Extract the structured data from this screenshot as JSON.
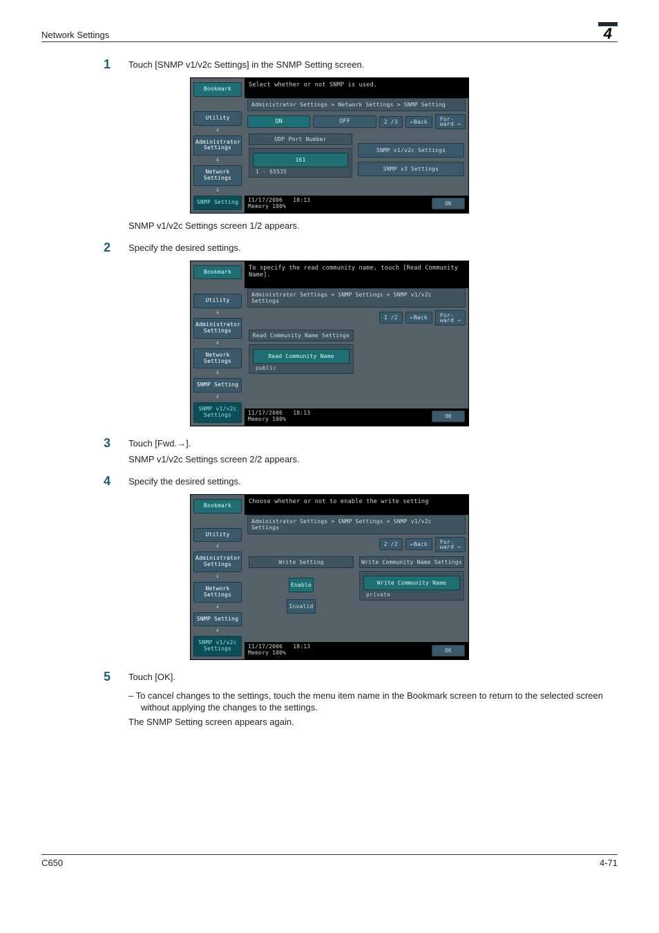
{
  "header": {
    "title": "Network Settings",
    "chapter": "4"
  },
  "steps": {
    "s1": {
      "num": "1",
      "text": "Touch [SNMP v1/v2c Settings] in the SNMP Setting screen.",
      "after": "SNMP v1/v2c Settings screen 1/2 appears."
    },
    "s2": {
      "num": "2",
      "text": "Specify the desired settings."
    },
    "s3": {
      "num": "3",
      "text": "Touch [Fwd.→].",
      "after": "SNMP v1/v2c Settings screen 2/2 appears."
    },
    "s4": {
      "num": "4",
      "text": "Specify the desired settings."
    },
    "s5": {
      "num": "5",
      "text": "Touch [OK].",
      "bullet": "–   To cancel changes to the settings, touch the menu item name in the Bookmark screen to return to the selected screen without applying the changes to the settings.",
      "after": "The SNMP Setting screen appears again."
    }
  },
  "footer": {
    "left": "C650",
    "right": "4-71"
  },
  "shot1": {
    "instr": "Select whether or not SNMP is used.",
    "crumb": "Administrator Settings > Network Settings > SNMP Setting",
    "on": "ON",
    "off": "OFF",
    "page": "2 /3",
    "back": "←Back",
    "fwd": "For-\nward →",
    "bm": {
      "book": "Bookmark",
      "utility": "Utility",
      "admin": "Administrator\nSettings",
      "net": "Network\nSettings",
      "snmp": "SNMP Setting"
    },
    "udpTitle": "UDP Port Number",
    "udpVal": "161",
    "udpRange": "1  -  65535",
    "btnV1": "SNMP v1/v2c Settings",
    "btnV3": "SNMP v3 Settings",
    "date": "11/17/2006",
    "time": "18:13",
    "mem": "Memory   100%",
    "ok": "OK"
  },
  "shot2": {
    "instr": "To specify the read community name, touch [Read Community Name].",
    "crumb": "Administrator Settings > SNMP Settings > SNMP v1/v2c Settings",
    "page": "1 /2",
    "back": "←Back",
    "fwd": "For-\nward →",
    "bm": {
      "book": "Bookmark",
      "utility": "Utility",
      "admin": "Administrator\nSettings",
      "net": "Network\nSettings",
      "snmp": "SNMP Setting",
      "v1": "SNMP v1/v2c\nSettings"
    },
    "panelTitle": "Read Community Name Settings",
    "btnRead": "Read Community Name",
    "val": "public",
    "date": "11/17/2006",
    "time": "18:13",
    "mem": "Memory   100%",
    "ok": "OK"
  },
  "shot3": {
    "instr": "Choose whether or not to enable the write setting",
    "crumb": "Administrator Settings > SNMP Settings > SNMP v1/v2c Settings",
    "page": "2 /2",
    "back": "←Back",
    "fwd": "For-\nward →",
    "bm": {
      "book": "Bookmark",
      "utility": "Utility",
      "admin": "Administrator\nSettings",
      "net": "Network\nSettings",
      "snmp": "SNMP Setting",
      "v1": "SNMP v1/v2c\nSettings"
    },
    "leftTitle": "Write Setting",
    "enable": "Enable",
    "invalid": "Invalid",
    "rightTitle": "Write Community Name Settings",
    "btnWrite": "Write Community Name",
    "val": "private",
    "date": "11/17/2006",
    "time": "18:13",
    "mem": "Memory   100%",
    "ok": "OK"
  }
}
